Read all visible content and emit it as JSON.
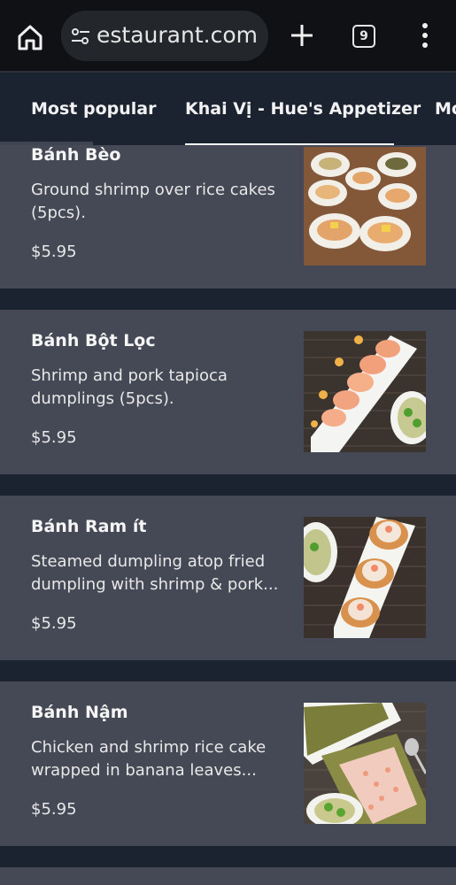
{
  "browser": {
    "url_text": "estaurant.com",
    "tab_count": "9"
  },
  "categories": [
    {
      "label": "Most popular"
    },
    {
      "label": "Khai Vị - Hue's Appetizer"
    },
    {
      "label": "Mó"
    }
  ],
  "items": [
    {
      "name": "Bánh Bèo",
      "description": "Ground shrimp over rice cakes (5pcs).",
      "price": "$5.95"
    },
    {
      "name": "Bánh Bột Lọc",
      "description": "Shrimp and pork tapioca dumplings (5pcs).",
      "price": "$5.95"
    },
    {
      "name": "Bánh Ram ít",
      "description": "Steamed dumpling atop fried dumpling with shrimp & pork...",
      "price": "$5.95"
    },
    {
      "name": "Bánh Nậm",
      "description": "Chicken and shrimp rice cake wrapped in banana leaves...",
      "price": "$5.95"
    }
  ],
  "colors": {
    "page_bg": "#1b2230",
    "card_bg": "#454955",
    "browser_bar": "#0f1114"
  }
}
